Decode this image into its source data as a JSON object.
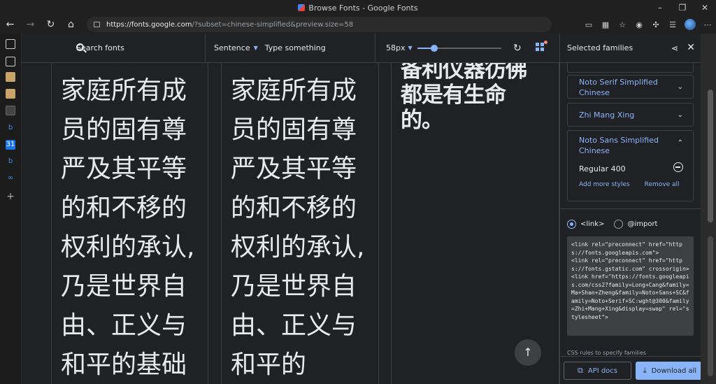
{
  "window": {
    "title": "Browse Fonts - Google Fonts",
    "controls": [
      "–",
      "❐",
      "✕"
    ]
  },
  "toolbar": {
    "url_host": "https://fonts.google.com",
    "url_rest": "/?subset=chinese-simplified&preview.size=58"
  },
  "filterbar": {
    "search_placeholder": "Search fonts",
    "mode": "Sentence",
    "type_placeholder": "Type something",
    "size": "58px",
    "slider_value": 0.2
  },
  "cards": [
    {
      "text": "家庭所有成员的固有尊严及其平等的和不移的权利的承认,乃是世界自由、正义与和平的基础"
    },
    {
      "text": "家庭所有成员的固有尊严及其平等的和不移的权利的承认,乃是世界自由、正义与和平的"
    },
    {
      "text": "备利仪器彷佛都是有生命的。"
    }
  ],
  "panel": {
    "title": "Selected families",
    "families": [
      {
        "name": "Noto Serif Simplified Chinese"
      },
      {
        "name": "Zhi Mang Xing"
      },
      {
        "name": "Noto Sans Simplified Chinese",
        "style": "Regular 400",
        "add_more": "Add more styles",
        "remove_all": "Remove all"
      }
    ],
    "embed": {
      "link_label": "<link>",
      "import_label": "@import",
      "code": "<link rel=\"preconnect\" href=\"https://fonts.googleapis.com\">\n<link rel=\"preconnect\" href=\"https://fonts.gstatic.com\" crossorigin>\n<link href=\"https://fonts.googleapis.com/css2?family=Long+Cang&family=Ma+Shan+Zheng&family=Noto+Sans+SC&family=Noto+Serif+SC:wght@300&family=Zhi+Mang+Xing&display=swap\" rel=\"stylesheet\">"
    },
    "css_hint": "CSS rules to specify families",
    "api_docs": "API docs",
    "download_all": "Download all"
  }
}
